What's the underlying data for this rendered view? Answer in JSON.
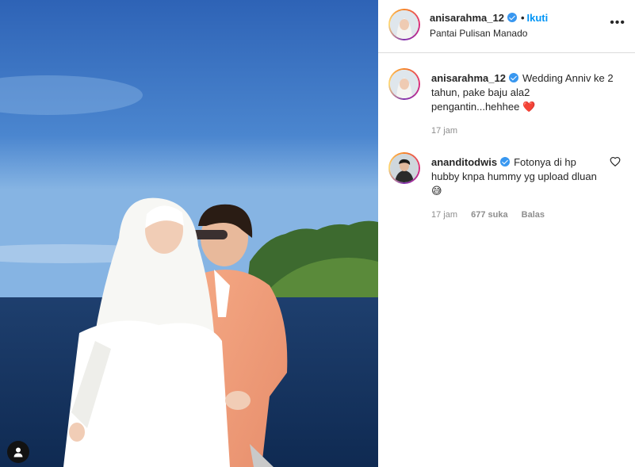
{
  "post": {
    "username": "anisarahma_12",
    "follow_label": "Ikuti",
    "separator": "•",
    "location": "Pantai Pulisan Manado",
    "more_label": "•••"
  },
  "caption": {
    "username": "anisarahma_12",
    "text": "Wedding Anniv ke 2 tahun, pake baju ala2 pengantin...hehhee",
    "emoji": "❤️",
    "time": "17 jam"
  },
  "reply": {
    "username": "ananditodwis",
    "text": "Fotonya di hp hubby knpa hummy yg upload dluan",
    "emoji": "😅",
    "time": "17 jam",
    "likes": "677 suka",
    "reply_label": "Balas"
  },
  "colors": {
    "link_blue": "#0095f6",
    "verified_blue": "#3897f0",
    "muted": "#8e8e8e"
  },
  "icons": [
    "verified-icon",
    "more-options-icon",
    "heart-icon",
    "user-tag-icon"
  ]
}
